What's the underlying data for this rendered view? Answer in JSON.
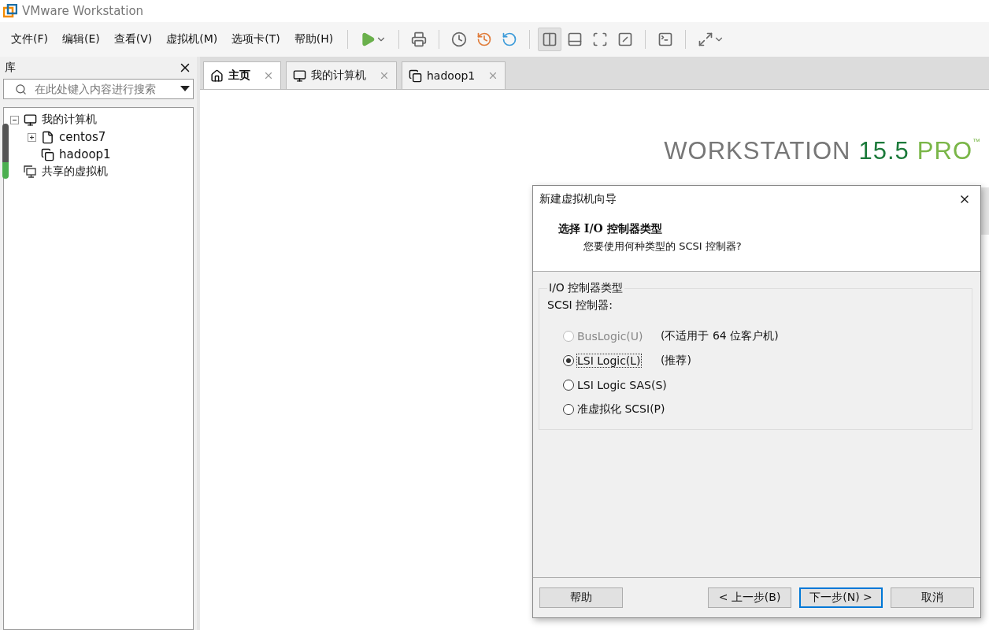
{
  "window": {
    "title": "VMware Workstation"
  },
  "menu": [
    "文件(F)",
    "编辑(E)",
    "查看(V)",
    "虚拟机(M)",
    "选项卡(T)",
    "帮助(H)"
  ],
  "library": {
    "title": "库",
    "search": {
      "placeholder": "在此处键入内容进行搜索"
    },
    "tree": [
      {
        "label": "我的计算机",
        "kind": "computer",
        "expanded": true,
        "children": [
          {
            "label": "centos7",
            "kind": "vm",
            "expanded": false
          },
          {
            "label": "hadoop1",
            "kind": "clone"
          }
        ]
      },
      {
        "label": "共享的虚拟机",
        "kind": "shared"
      }
    ]
  },
  "tabs": [
    {
      "label": "主页",
      "kind": "home",
      "selected": true
    },
    {
      "label": "我的计算机",
      "kind": "computer",
      "selected": false
    },
    {
      "label": "hadoop1",
      "kind": "clone",
      "selected": false
    }
  ],
  "brand": {
    "name": "WORKSTATION",
    "version": "15.5",
    "edition": "PRO",
    "mark": "™"
  },
  "dialog": {
    "title": "新建虚拟机向导",
    "heading": "选择 I/O 控制器类型",
    "subheading": "您要使用何种类型的 SCSI 控制器?",
    "group_title": "I/O 控制器类型",
    "group_label": "SCSI 控制器:",
    "options": [
      {
        "label": "BusLogic(U)",
        "note": "(不适用于 64 位客户机)",
        "selected": false,
        "disabled": true
      },
      {
        "label": "LSI Logic(L)",
        "note": "(推荐)",
        "selected": true,
        "disabled": false
      },
      {
        "label": "LSI Logic SAS(S)",
        "selected": false,
        "disabled": false
      },
      {
        "label": "准虚拟化 SCSI(P)",
        "selected": false,
        "disabled": false
      }
    ],
    "buttons": [
      {
        "label": "帮助",
        "kind": "help",
        "default": false
      },
      {
        "label": "< 上一步(B)",
        "kind": "nav",
        "default": false
      },
      {
        "label": "下一步(N) >",
        "kind": "nav",
        "default": true
      },
      {
        "label": "取消",
        "kind": "nav",
        "default": false
      }
    ]
  }
}
